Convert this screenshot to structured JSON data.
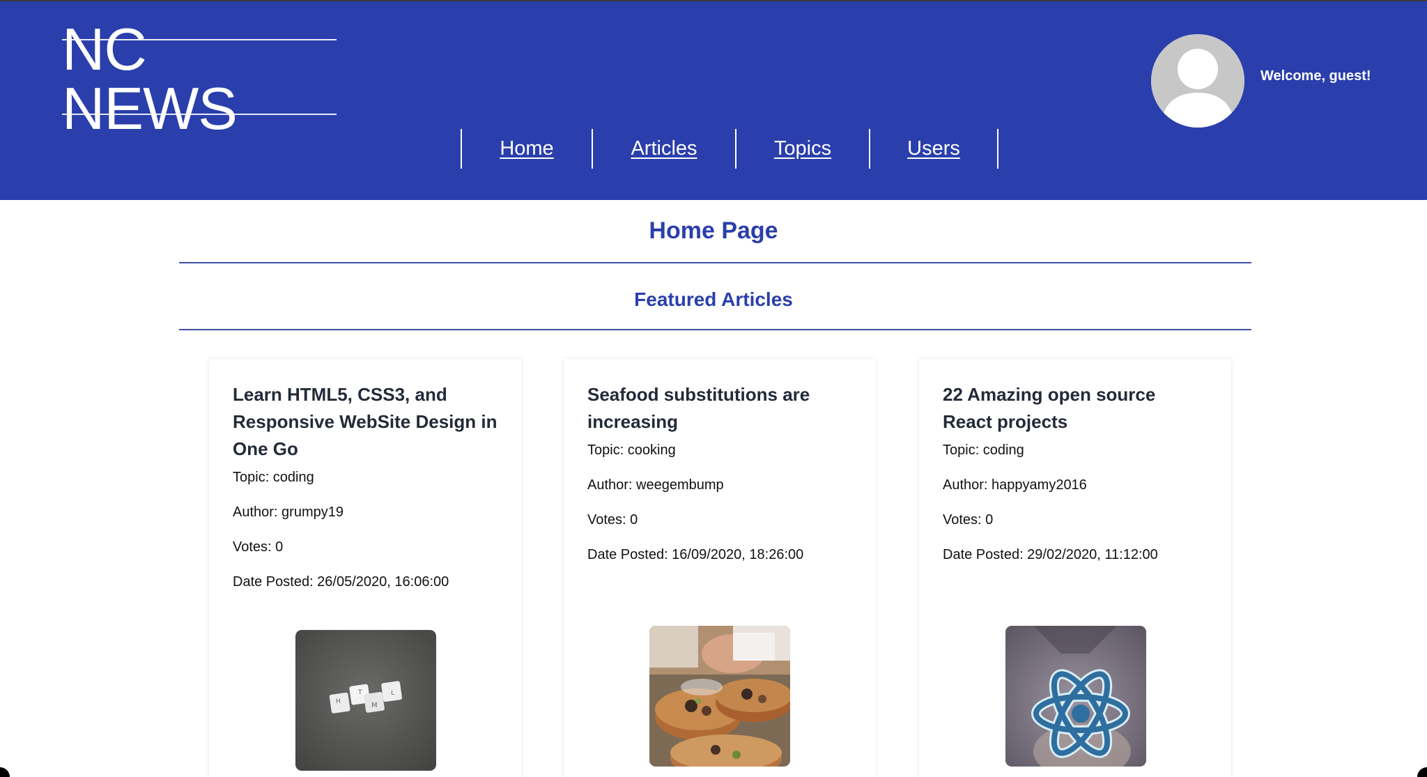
{
  "header": {
    "logo": "NC NEWS",
    "welcome": "Welcome, guest!",
    "nav": [
      {
        "label": "Home"
      },
      {
        "label": "Articles"
      },
      {
        "label": "Topics"
      },
      {
        "label": "Users"
      }
    ],
    "colors": {
      "background": "#2a3fac",
      "text": "#ffffff"
    }
  },
  "main": {
    "page_title": "Home Page",
    "section_title": "Featured Articles",
    "articles": [
      {
        "title": "Learn HTML5, CSS3, and Responsive WebSite Design in One Go",
        "topic": "Topic: coding",
        "author": "Author: grumpy19",
        "votes": "Votes: 0",
        "date": "Date Posted: 26/05/2020, 16:06:00",
        "image_icon": "html-tiles-image"
      },
      {
        "title": "Seafood substitutions are increasing",
        "topic": "Topic: cooking",
        "author": "Author: weegembump",
        "votes": "Votes: 0",
        "date": "Date Posted: 16/09/2020, 18:26:00",
        "image_icon": "seafood-plating-image"
      },
      {
        "title": "22 Amazing open source React projects",
        "topic": "Topic: coding",
        "author": "Author: happyamy2016",
        "votes": "Votes: 0",
        "date": "Date Posted: 29/02/2020, 11:12:00",
        "image_icon": "react-logo-image"
      }
    ]
  }
}
